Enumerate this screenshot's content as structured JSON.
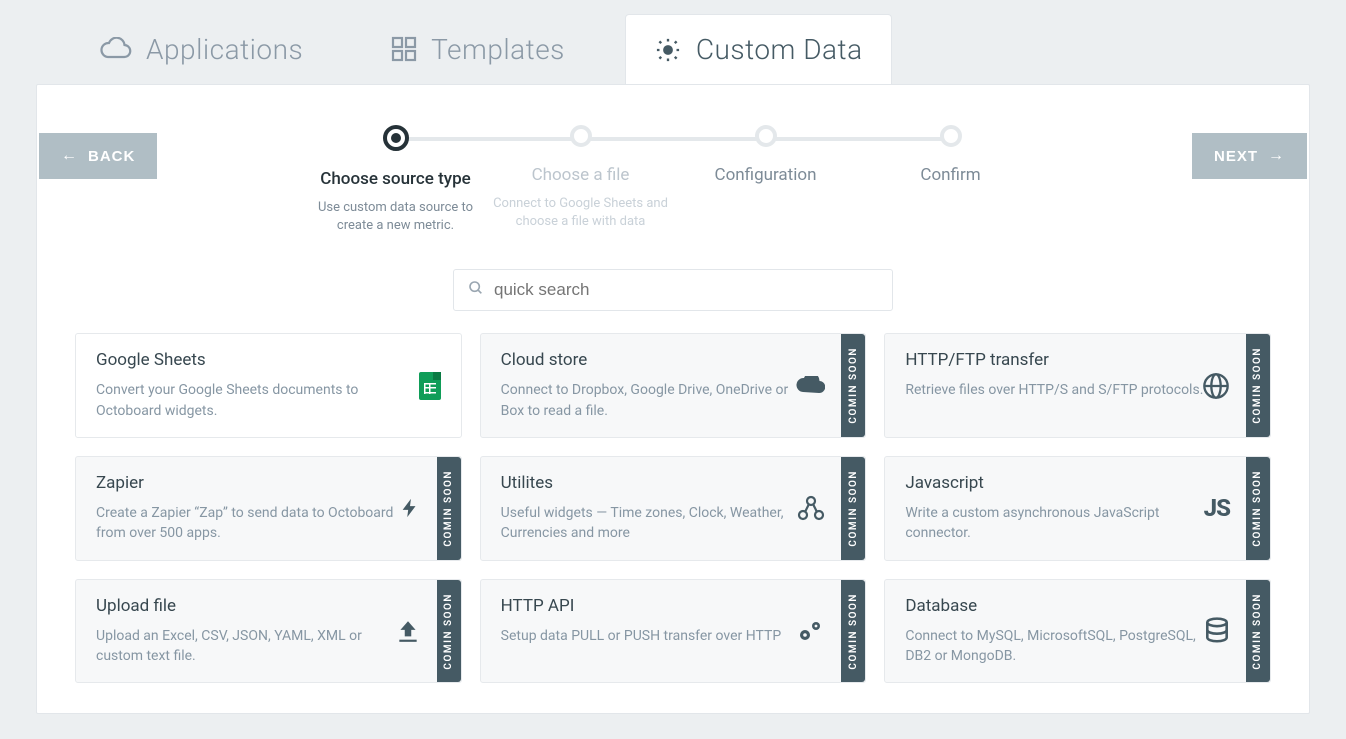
{
  "tabs": {
    "applications": "Applications",
    "templates": "Templates",
    "custom": "Custom Data"
  },
  "buttons": {
    "back": "BACK",
    "next": "NEXT"
  },
  "stepper": {
    "steps": [
      {
        "title": "Choose source type",
        "sub": "Use custom data source to create a new metric."
      },
      {
        "title": "Choose a file",
        "sub": "Connect to Google Sheets and choose a file with data"
      },
      {
        "title": "Configuration",
        "sub": ""
      },
      {
        "title": "Confirm",
        "sub": ""
      }
    ]
  },
  "search": {
    "placeholder": "quick search"
  },
  "badge_text": "COMIN SOON",
  "cards": [
    {
      "title": "Google Sheets",
      "desc": "Convert your Google Sheets documents to Octoboard widgets."
    },
    {
      "title": "Cloud store",
      "desc": "Connect to Dropbox, Google Drive, OneDrive or Box to read a file."
    },
    {
      "title": "HTTP/FTP transfer",
      "desc": "Retrieve files over HTTP/S and S/FTP protocols."
    },
    {
      "title": "Zapier",
      "desc": "Create a Zapier “Zap” to send data to Octoboard from over 500 apps."
    },
    {
      "title": "Utilites",
      "desc": "Useful widgets — Time zones, Clock, Weather, Currencies and more"
    },
    {
      "title": "Javascript",
      "desc": "Write a custom asynchronous JavaScript connector."
    },
    {
      "title": "Upload file",
      "desc": "Upload an Excel, CSV, JSON, YAML, XML or custom text file."
    },
    {
      "title": "HTTP API",
      "desc": "Setup data PULL or PUSH transfer over HTTP"
    },
    {
      "title": "Database",
      "desc": "Connect to MySQL, MicrosoftSQL, PostgreSQL, DB2 or MongoDB."
    }
  ]
}
